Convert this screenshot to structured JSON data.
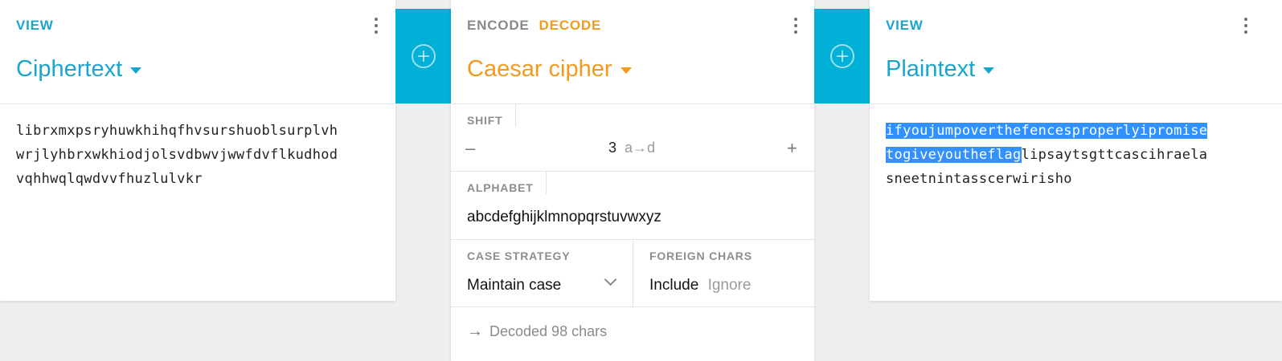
{
  "left_panel": {
    "kind_label": "VIEW",
    "title": "Ciphertext",
    "content_lines": [
      "librxmxpsryhuwkhihqfhvsurshuoblsurplvh",
      "wrjlyhbrxwkhiodjolsvdbwvjwwfdvflkudhod",
      "vqhhwqlqwdvvfhuzlulvkr"
    ]
  },
  "middle_panel": {
    "mode_encode": "ENCODE",
    "mode_decode": "DECODE",
    "title": "Caesar cipher",
    "shift": {
      "label": "SHIFT",
      "minus": "–",
      "value": "3",
      "mapping": "a→d",
      "plus": "+"
    },
    "alphabet": {
      "label": "ALPHABET",
      "value": "abcdefghijklmnopqrstuvwxyz"
    },
    "case_strategy": {
      "label": "CASE STRATEGY",
      "value": "Maintain case"
    },
    "foreign_chars": {
      "label": "FOREIGN CHARS",
      "option_include": "Include",
      "option_ignore": "Ignore"
    },
    "status": "Decoded 98 chars"
  },
  "right_panel": {
    "kind_label": "VIEW",
    "title": "Plaintext",
    "line1_selected": "ifyoujumpoverthefencesproperlyipromise",
    "line2_selected": "togiveyoutheflag",
    "line2_rest": "lipsaytsgttcascihraela",
    "line3": "sneetnintasscerwirisho"
  },
  "colors": {
    "accent_blue": "#1aa5cf",
    "accent_orange": "#f39a1e",
    "add_bar": "#00b0d6",
    "selection": "#3390ff"
  },
  "icons": {
    "more": "more-vertical-icon",
    "add": "add-circle-icon",
    "arrow": "arrow-right-icon"
  }
}
